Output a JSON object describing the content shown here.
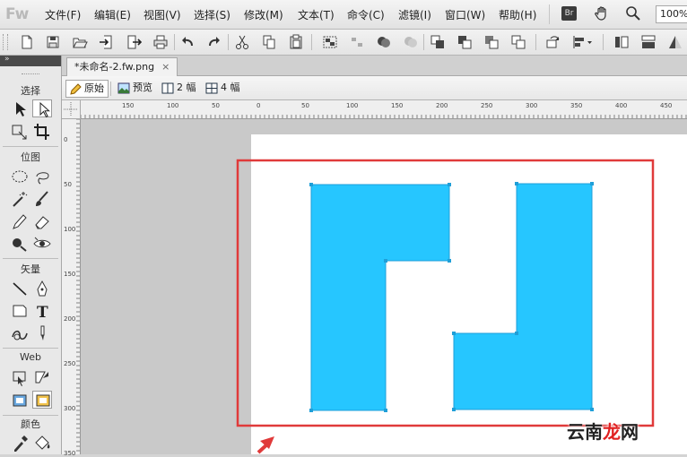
{
  "app": {
    "logo": "Fw"
  },
  "menu": [
    {
      "id": "file",
      "label": "文件(F)"
    },
    {
      "id": "edit",
      "label": "编辑(E)"
    },
    {
      "id": "view",
      "label": "视图(V)"
    },
    {
      "id": "select",
      "label": "选择(S)"
    },
    {
      "id": "modify",
      "label": "修改(M)"
    },
    {
      "id": "text",
      "label": "文本(T)"
    },
    {
      "id": "commands",
      "label": "命令(C)"
    },
    {
      "id": "filters",
      "label": "滤镜(I)"
    },
    {
      "id": "window",
      "label": "窗口(W)"
    },
    {
      "id": "help",
      "label": "帮助(H)"
    }
  ],
  "menubar_right": {
    "bridge_label": "Br",
    "zoom_value": "100%"
  },
  "toolbar_icons": [
    "new-icon",
    "save-icon",
    "open-icon",
    "import-icon",
    "export-icon",
    "print-icon",
    "undo-icon",
    "redo-icon",
    "cut-icon",
    "copy-icon",
    "paste-icon",
    "group-icon",
    "ungroup-icon",
    "join-icon",
    "split-icon",
    "bring-front-icon",
    "bring-forward-icon",
    "send-backward-icon",
    "send-back-icon",
    "rotate-icon",
    "align-icon",
    "flip-horizontal-icon",
    "flip-vertical-icon",
    "triangle-icon"
  ],
  "tools_panel": {
    "sections": {
      "select": "选择",
      "bitmap": "位图",
      "vector": "矢量",
      "web": "Web",
      "colors": "颜色"
    }
  },
  "document": {
    "tab_title": "*未命名-2.fw.png",
    "close_glyph": "×"
  },
  "view_modes": [
    {
      "id": "original",
      "label": "原始",
      "active": true
    },
    {
      "id": "preview",
      "label": "预览",
      "active": false
    },
    {
      "id": "2up",
      "label": "2 幅",
      "active": false
    },
    {
      "id": "4up",
      "label": "4 幅",
      "active": false
    }
  ],
  "rulers": {
    "top_labels": [
      "150",
      "100",
      "50",
      "0",
      "50",
      "100",
      "150",
      "200",
      "250",
      "300",
      "350",
      "400",
      "450"
    ],
    "left_labels": [
      "0",
      "50",
      "100",
      "150",
      "200",
      "250",
      "300",
      "350"
    ]
  },
  "colors": {
    "shape_fill": "#26c6ff",
    "shape_stroke": "#1f9fd8",
    "highlight_box": "#e03a3a",
    "arrow": "#e03a3a"
  },
  "watermark": {
    "part1": "云南",
    "part2": "龙",
    "part3": "网"
  }
}
